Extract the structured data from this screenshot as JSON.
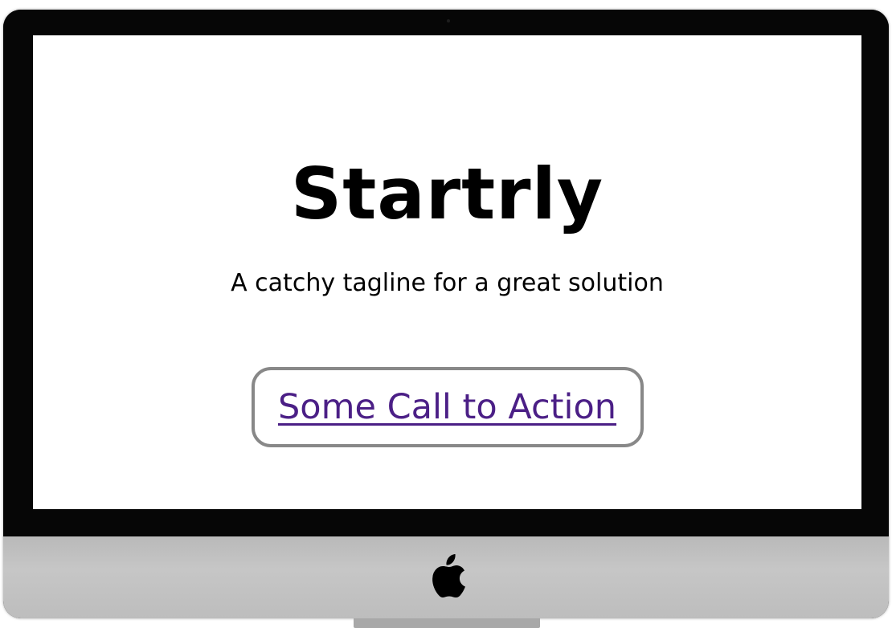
{
  "page": {
    "brand": "Startrly",
    "tagline": "A catchy tagline for a great solution",
    "cta_label": "Some Call to Action"
  },
  "colors": {
    "link": "#4b1f86",
    "cta_border": "#888888",
    "bezel": "#060606",
    "chin": "#c0c0c0"
  },
  "icons": {
    "device_logo": "apple-logo-icon"
  }
}
